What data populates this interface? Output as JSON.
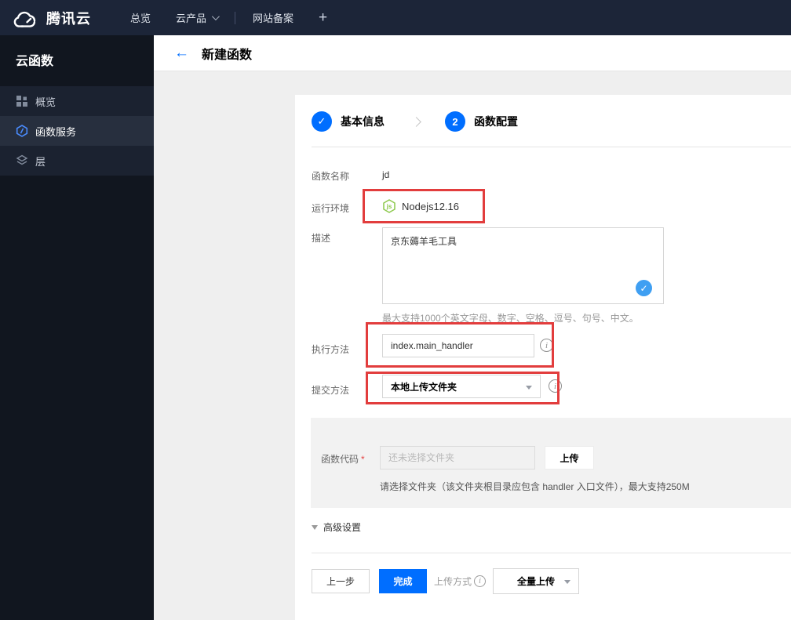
{
  "colors": {
    "accent": "#006eff",
    "annotation_red": "#e23d3d",
    "node_green": "#8cc84b",
    "badge_blue": "#3f9ff2"
  },
  "icons": {
    "check": "✓",
    "back_arrow": "←",
    "plus": "+",
    "info": "i",
    "nodejs_letters": "js",
    "required_asterisk": "*"
  },
  "topnav": {
    "brand": "腾讯云",
    "overview": "总览",
    "products": "云产品",
    "beian": "网站备案"
  },
  "sidebar": {
    "title": "云函数",
    "items": [
      {
        "label": "概览"
      },
      {
        "label": "函数服务"
      },
      {
        "label": "层"
      }
    ]
  },
  "header": {
    "title": "新建函数"
  },
  "steps": {
    "step1": {
      "label": "基本信息"
    },
    "step2": {
      "number": "2",
      "label": "函数配置"
    }
  },
  "form": {
    "name": {
      "label": "函数名称",
      "value": "jd"
    },
    "runtime": {
      "label": "运行环境",
      "value": "Nodejs12.16"
    },
    "description": {
      "label": "描述",
      "value": "京东薅羊毛工具",
      "hint": "最大支持1000个英文字母、数字、空格、逗号、句号、中文。"
    },
    "handler": {
      "label": "执行方法",
      "value": "index.main_handler"
    },
    "submit_method": {
      "label": "提交方法",
      "value": "本地上传文件夹"
    },
    "code": {
      "label": "函数代码",
      "placeholder": "还未选择文件夹",
      "upload_button": "上传",
      "hint": "请选择文件夹（该文件夹根目录应包含 handler 入口文件），最大支持250M"
    },
    "advanced": {
      "label": "高级设置"
    }
  },
  "footer": {
    "prev": "上一步",
    "finish": "完成",
    "upload_mode_label": "上传方式",
    "upload_mode_value": "全量上传"
  }
}
